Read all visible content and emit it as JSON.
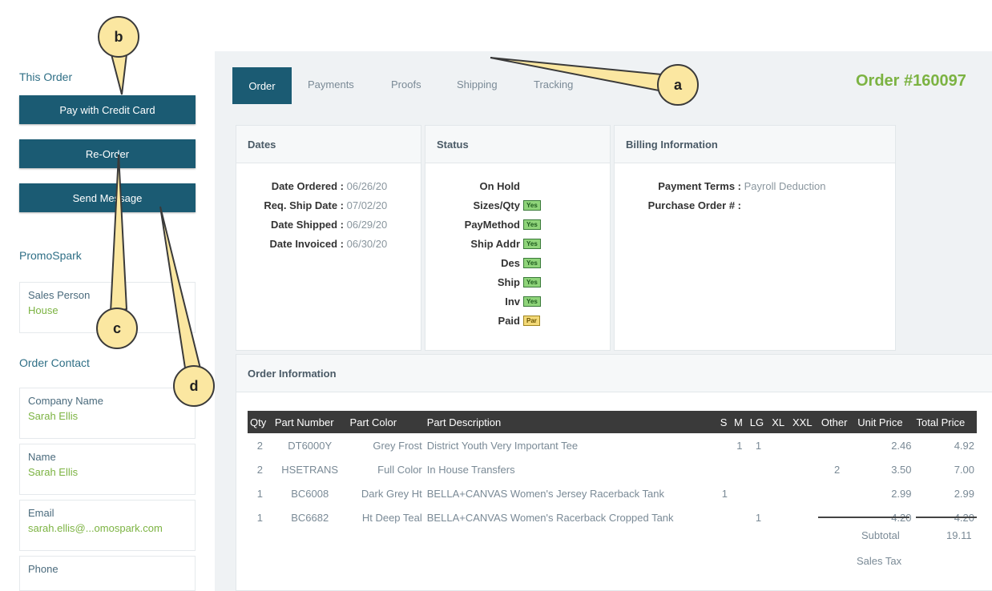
{
  "sidebar": {
    "this_order_heading": "This Order",
    "buttons": [
      "Pay with Credit Card",
      "Re-Order",
      "Send Message"
    ],
    "company_heading": "PromoSpark",
    "sales_person": {
      "label": "Sales Person",
      "value": "House"
    },
    "order_contact_heading": "Order Contact",
    "contact_fields": [
      {
        "label": "Company Name",
        "value": "Sarah Ellis"
      },
      {
        "label": "Name",
        "value": "Sarah Ellis"
      },
      {
        "label": "Email",
        "value": "sarah.ellis@...omospark.com"
      },
      {
        "label": "Phone",
        "value": ""
      }
    ]
  },
  "tabs": [
    "Order",
    "Payments",
    "Proofs",
    "Shipping",
    "Tracking"
  ],
  "order_title": "Order #160097",
  "dates": {
    "heading": "Dates",
    "rows": [
      {
        "label": "Date Ordered :",
        "value": "06/26/20"
      },
      {
        "label": "Req. Ship Date :",
        "value": "07/02/20"
      },
      {
        "label": "Date Shipped :",
        "value": "06/29/20"
      },
      {
        "label": "Date Invoiced :",
        "value": "06/30/20"
      }
    ]
  },
  "status": {
    "heading": "Status",
    "rows": [
      {
        "label": "On Hold",
        "badge": ""
      },
      {
        "label": "Sizes/Qty",
        "badge": "Yes"
      },
      {
        "label": "PayMethod",
        "badge": "Yes"
      },
      {
        "label": "Ship Addr",
        "badge": "Yes"
      },
      {
        "label": "Des",
        "badge": "Yes"
      },
      {
        "label": "Ship",
        "badge": "Yes"
      },
      {
        "label": "Inv",
        "badge": "Yes"
      },
      {
        "label": "Paid",
        "badge": "Par"
      }
    ]
  },
  "billing": {
    "heading": "Billing Information",
    "payment_terms_label": "Payment Terms :",
    "payment_terms_value": "Payroll Deduction",
    "po_label": "Purchase Order # :"
  },
  "order_info": {
    "heading": "Order Information",
    "columns": [
      "Qty",
      "Part Number",
      "Part Color",
      "Part Description",
      "S",
      "M",
      "LG",
      "XL",
      "XXL",
      "Other",
      "Unit Price",
      "Total Price"
    ],
    "rows": [
      [
        "2",
        "DT6000Y",
        "Grey Frost",
        "District Youth Very Important Tee",
        "",
        "1",
        "1",
        "",
        "",
        "",
        "2.46",
        "4.92"
      ],
      [
        "2",
        "HSETRANS",
        "Full Color",
        "In House Transfers",
        "",
        "",
        "",
        "",
        "",
        "2",
        "3.50",
        "7.00"
      ],
      [
        "1",
        "BC6008",
        "Dark Grey Ht",
        "BELLA+CANVAS Women's Jersey Racerback Tank",
        "1",
        "",
        "",
        "",
        "",
        "",
        "2.99",
        "2.99"
      ],
      [
        "1",
        "BC6682",
        "Ht Deep Teal",
        "BELLA+CANVAS Women's Racerback Cropped Tank",
        "",
        "",
        "1",
        "",
        "",
        "",
        "4.20",
        "4.20"
      ]
    ],
    "subtotal_label": "Subtotal",
    "subtotal_value": "19.11",
    "sales_tax_label": "Sales Tax"
  },
  "callouts": [
    "a",
    "b",
    "c",
    "d"
  ],
  "colors": {
    "primary": "#1b5b73",
    "accent_green": "#7cb342",
    "callout_fill": "#fbe7a1"
  }
}
